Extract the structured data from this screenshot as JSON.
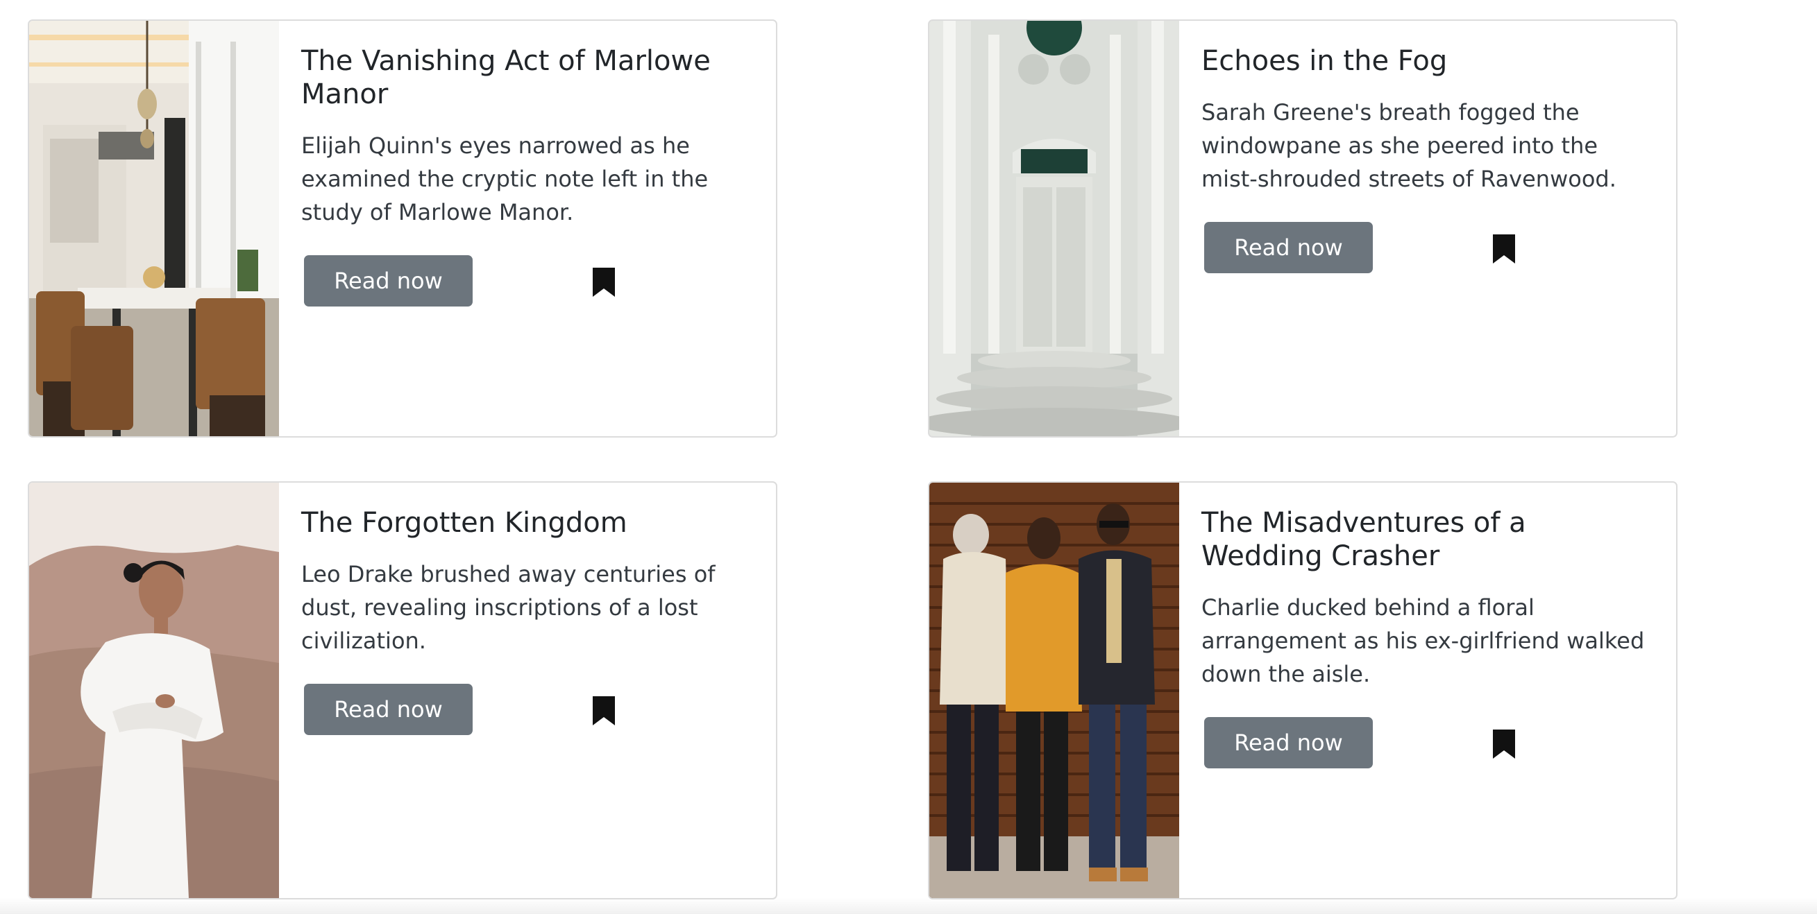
{
  "cards": [
    {
      "title": "The Vanishing Act of Marlowe Manor",
      "text": "Elijah Quinn's eyes narrowed as he examined the cryptic note left in the study of Marlowe Manor.",
      "button_label": "Read now",
      "image": "restaurant-interior-photo",
      "bookmark_icon": "bookmark-icon"
    },
    {
      "title": "Echoes in the Fog",
      "text": "Sarah Greene's breath fogged the windowpane as she peered into the mist-shrouded streets of Ravenwood.",
      "button_label": "Read now",
      "image": "ornate-white-doorway-photo",
      "bookmark_icon": "bookmark-icon"
    },
    {
      "title": "The Forgotten Kingdom",
      "text": "Leo Drake brushed away centuries of dust, revealing inscriptions of a lost civilization.",
      "button_label": "Read now",
      "image": "woman-in-desert-photo",
      "bookmark_icon": "bookmark-icon"
    },
    {
      "title": "The Misadventures of a Wedding Crasher",
      "text": "Charlie ducked behind a floral arrangement as his ex-girlfriend walked down the aisle.",
      "button_label": "Read now",
      "image": "three-men-fashion-photo",
      "bookmark_icon": "bookmark-icon"
    }
  ],
  "colors": {
    "button_bg": "#6c757d",
    "button_text": "#ffffff",
    "card_border": "#dcdcdc",
    "title_text": "#212529",
    "body_text": "#343a40"
  }
}
